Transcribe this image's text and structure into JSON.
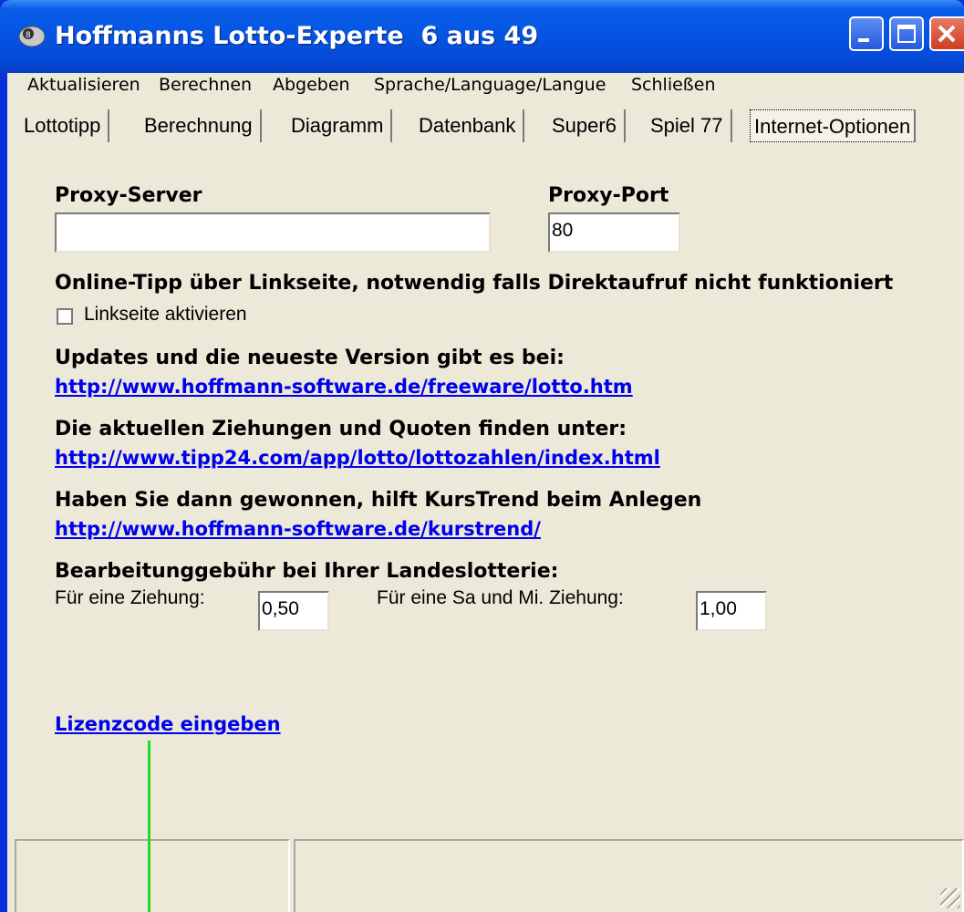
{
  "window": {
    "title": "Hoffmanns Lotto-Experte  6 aus 49",
    "icon": "lotto-ball-icon",
    "controls": [
      "minimize-icon",
      "maximize-icon",
      "close-icon"
    ]
  },
  "menu": {
    "items": [
      {
        "label": "Aktualisieren"
      },
      {
        "label": "Berechnen"
      },
      {
        "label": "Abgeben"
      },
      {
        "label": "Sprache/Language/Langue"
      },
      {
        "label": "Schließen"
      }
    ]
  },
  "tabs": [
    {
      "label": "Lottotipp"
    },
    {
      "label": "Berechnung"
    },
    {
      "label": "Diagramm"
    },
    {
      "label": "Datenbank"
    },
    {
      "label": "Super6"
    },
    {
      "label": "Spiel 77"
    },
    {
      "label": "Internet-Optionen",
      "active": true
    }
  ],
  "proxy": {
    "server_label": "Proxy-Server",
    "server_value": "",
    "port_label": "Proxy-Port",
    "port_value": "80"
  },
  "online_tipp": {
    "heading": "Online-Tipp über Linkseite, notwendig falls Direktaufruf nicht funktioniert",
    "checkbox_label": "Linkseite aktivieren",
    "checked": false
  },
  "updates": {
    "heading": "Updates und die neueste Version gibt es bei:",
    "link": "http://www.hoffmann-software.de/freeware/lotto.htm"
  },
  "draws": {
    "heading": "Die aktuellen Ziehungen und Quoten finden unter:",
    "link": "http://www.tipp24.com/app/lotto/lottozahlen/index.html"
  },
  "kurstrend": {
    "heading": "Haben Sie dann gewonnen, hilft KursTrend beim Anlegen",
    "link": "http://www.hoffmann-software.de/kurstrend/"
  },
  "fees": {
    "heading": "Bearbeitunggebühr bei Ihrer Landeslotterie:",
    "single_label": "Für eine Ziehung:",
    "single_value": "0,50",
    "double_label": "Für eine Sa und Mi. Ziehung:",
    "double_value": "1,00"
  },
  "license_link": "Lizenzcode eingeben",
  "colors": {
    "titlebar": "#0553e1",
    "client_bg": "#ece9d8",
    "link": "#0000ee",
    "annotation_line": "#22dd22"
  }
}
